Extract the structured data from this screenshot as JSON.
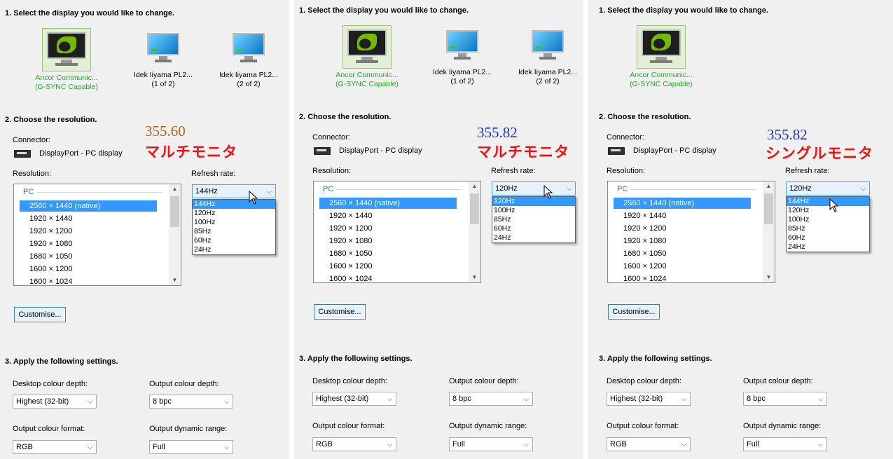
{
  "steps": {
    "select_display": "1. Select the display you would like to change.",
    "choose_resolution": "2. Choose the resolution.",
    "apply_settings": "3. Apply the following settings."
  },
  "labels": {
    "connector": "Connector:",
    "resolution": "Resolution:",
    "refresh_rate": "Refresh rate:",
    "customise": "Customise...",
    "desktop_colour_depth": "Desktop colour depth:",
    "output_colour_depth": "Output colour depth:",
    "output_colour_format": "Output colour format:",
    "output_dynamic_range": "Output dynamic range:"
  },
  "monitors": {
    "ancor": {
      "line1": "Ancor Communic...",
      "line2": "(G-SYNC Capable)"
    },
    "iiyama1": {
      "line1": "Idek Iiyama PL2...",
      "line2": "(1 of 2)"
    },
    "iiyama2": {
      "line1": "Idek Iiyama PL2...",
      "line2": "(2 of 2)"
    }
  },
  "connector_value": "DisplayPort - PC display",
  "resolution_group": "PC",
  "resolutions": [
    "2560 × 1440 (native)",
    "1920 × 1440",
    "1920 × 1200",
    "1920 × 1080",
    "1680 × 1050",
    "1600 × 1200",
    "1600 × 1024"
  ],
  "settings": {
    "desktop_colour_depth": "Highest (32-bit)",
    "output_colour_depth": "8 bpc",
    "output_colour_format": "RGB",
    "output_dynamic_range": "Full"
  },
  "panels": [
    {
      "score": "355.60",
      "score_color": "#b5651d",
      "mode": "マルチモニタ",
      "refresh_value": "144Hz",
      "refresh_options": [
        "144Hz",
        "120Hz",
        "100Hz",
        "85Hz",
        "60Hz",
        "24Hz"
      ]
    },
    {
      "score": "355.82",
      "score_color": "#1a2fd6",
      "mode": "マルチモニタ",
      "refresh_value": "120Hz",
      "refresh_options": [
        "120Hz",
        "100Hz",
        "85Hz",
        "60Hz",
        "24Hz"
      ]
    },
    {
      "score": "355.82",
      "score_color": "#1a2fd6",
      "mode": "シングルモニタ",
      "refresh_value": "120Hz",
      "refresh_options": [
        "144Hz",
        "120Hz",
        "100Hz",
        "85Hz",
        "60Hz",
        "24Hz"
      ]
    }
  ],
  "colors": {
    "selected_text": "#29a829",
    "list_highlight": "#3399ff",
    "mode_text": "#ee1111"
  }
}
